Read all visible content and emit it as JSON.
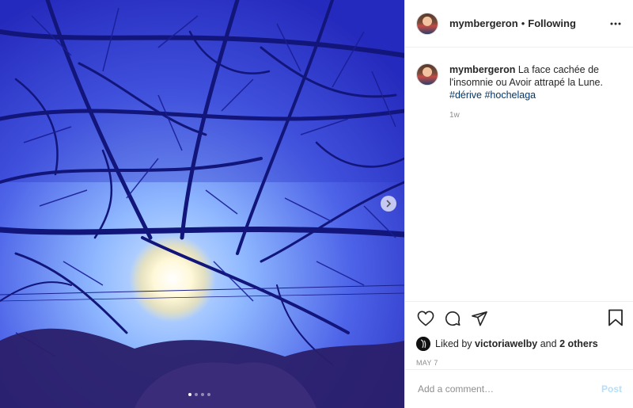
{
  "post": {
    "username": "mymbergeron",
    "separator": "•",
    "follow_status": "Following",
    "more_icon": "more-horizontal-icon"
  },
  "caption": {
    "username": "mymbergeron",
    "text": "La face cachée de l'insomnie ou Avoir attrapé la Lune.",
    "hashtags": [
      "#dérive",
      "#hochelaga"
    ],
    "time_ago": "1w"
  },
  "actions": {
    "like_icon": "heart-icon",
    "comment_icon": "comment-icon",
    "share_icon": "share-icon",
    "save_icon": "bookmark-icon"
  },
  "likes": {
    "prefix": "Liked by",
    "user": "victoriawelby",
    "conjunction": "and",
    "others": "2 others"
  },
  "date": "MAY 7",
  "comment": {
    "placeholder": "Add a comment…",
    "post_label": "Post"
  },
  "carousel": {
    "current": 1,
    "total": 4,
    "next_icon": "chevron-right-icon"
  }
}
